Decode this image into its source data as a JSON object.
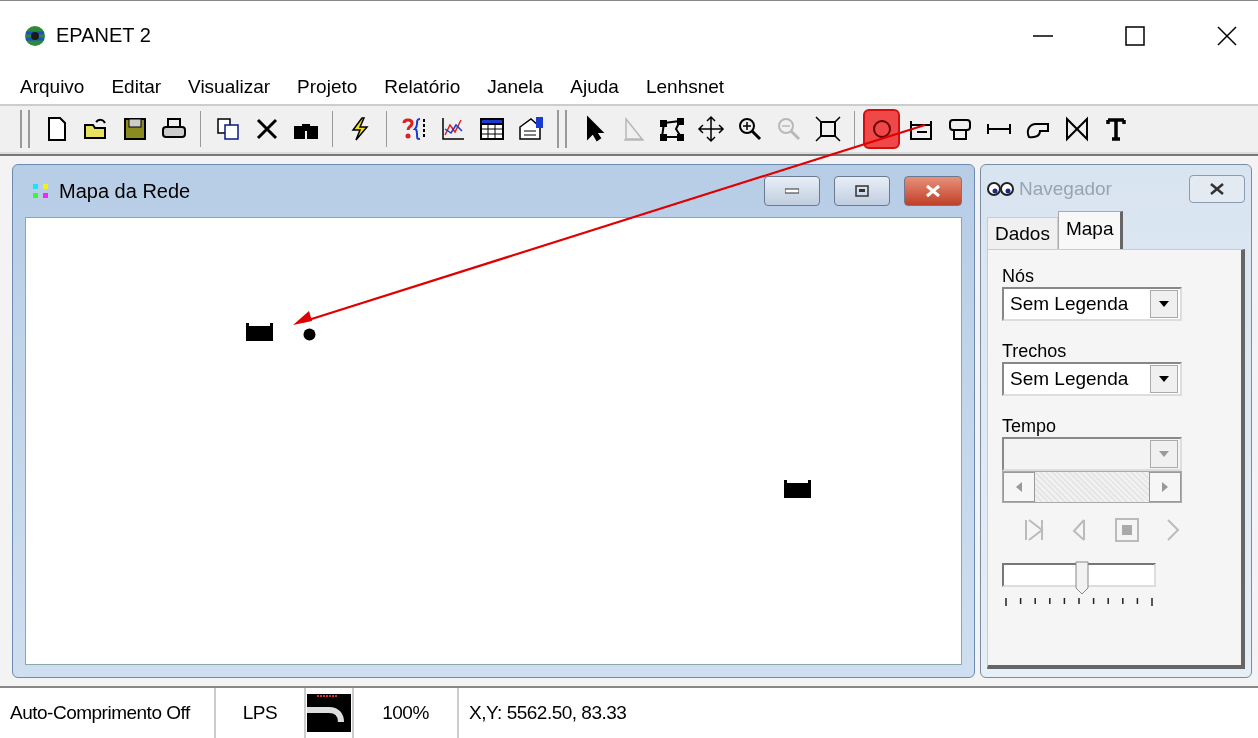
{
  "window": {
    "title": "EPANET 2"
  },
  "menu": [
    "Arquivo",
    "Editar",
    "Visualizar",
    "Projeto",
    "Relatório",
    "Janela",
    "Ajuda",
    "Lenhsnet"
  ],
  "toolbar": [
    [
      {
        "kind": "new",
        "disabled": false,
        "selected": false
      },
      {
        "kind": "open",
        "disabled": false,
        "selected": false
      },
      {
        "kind": "save",
        "disabled": false,
        "selected": false
      },
      {
        "kind": "print",
        "disabled": false,
        "selected": false
      }
    ],
    [
      {
        "kind": "copy",
        "disabled": false,
        "selected": false
      },
      {
        "kind": "delete",
        "disabled": false,
        "selected": false
      },
      {
        "kind": "find",
        "disabled": false,
        "selected": false
      }
    ],
    [
      {
        "kind": "run",
        "disabled": false,
        "selected": false
      }
    ],
    [
      {
        "kind": "query",
        "disabled": false,
        "selected": false
      },
      {
        "kind": "graph",
        "disabled": false,
        "selected": false
      },
      {
        "kind": "table",
        "disabled": false,
        "selected": false
      },
      {
        "kind": "options",
        "disabled": false,
        "selected": false
      }
    ],
    [
      {
        "kind": "select",
        "disabled": false,
        "selected": false
      },
      {
        "kind": "vertex",
        "disabled": true,
        "selected": false
      },
      {
        "kind": "region",
        "disabled": false,
        "selected": false
      },
      {
        "kind": "pan",
        "disabled": false,
        "selected": false
      },
      {
        "kind": "zoomin",
        "disabled": false,
        "selected": false
      },
      {
        "kind": "zoomout",
        "disabled": true,
        "selected": false
      },
      {
        "kind": "extent",
        "disabled": false,
        "selected": false
      }
    ],
    [
      {
        "kind": "junction",
        "disabled": false,
        "selected": true
      },
      {
        "kind": "reservoir",
        "disabled": false,
        "selected": false
      },
      {
        "kind": "tank",
        "disabled": false,
        "selected": false
      },
      {
        "kind": "pipe",
        "disabled": false,
        "selected": false
      },
      {
        "kind": "pump",
        "disabled": false,
        "selected": false
      },
      {
        "kind": "valve",
        "disabled": false,
        "selected": false
      },
      {
        "kind": "label",
        "disabled": false,
        "selected": false
      }
    ]
  ],
  "map_window": {
    "title": "Mapa da Rede",
    "nodes": [
      {
        "kind": "reservoir"
      },
      {
        "kind": "junction"
      },
      {
        "kind": "reservoir"
      }
    ]
  },
  "navigator": {
    "title": "Navegador",
    "tabs": [
      {
        "label": "Dados",
        "selected": false
      },
      {
        "label": "Mapa",
        "selected": true
      }
    ],
    "fields": [
      {
        "label": "Nós",
        "value": "Sem Legenda",
        "disabled": false
      },
      {
        "label": "Trechos",
        "value": "Sem Legenda",
        "disabled": false
      },
      {
        "label": "Tempo",
        "disabled": true
      }
    ],
    "player_disabled": true,
    "speed": {
      "level": 0.52
    }
  },
  "status_bar": {
    "auto_length": "Auto-Comprimento Off",
    "units": "LPS",
    "zoom": "100%",
    "coordinates": "X,Y: 5562.50, 83.33"
  }
}
